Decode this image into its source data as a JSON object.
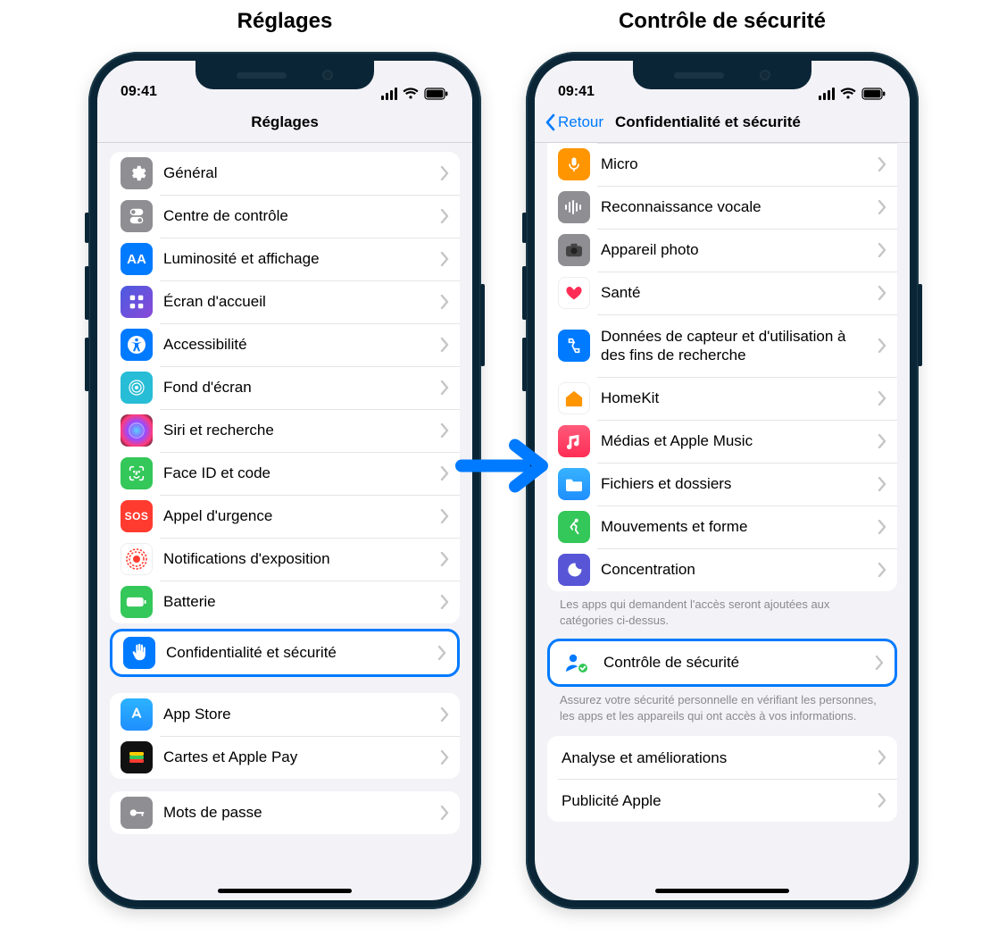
{
  "labels": {
    "left_title": "Réglages",
    "right_title": "Contrôle de sécurité"
  },
  "status": {
    "time": "09:41"
  },
  "phoneLeft": {
    "nav": {
      "title": "Réglages"
    },
    "group1": [
      {
        "label": "Général",
        "icon": "gear",
        "bg": "#8e8e93"
      },
      {
        "label": "Centre de contrôle",
        "icon": "control",
        "bg": "#8e8e93"
      },
      {
        "label": "Luminosité et affichage",
        "icon": "display",
        "bg": "#007aff"
      },
      {
        "label": "Écran d'accueil",
        "icon": "home-grid",
        "bg": "#3a3ad6"
      },
      {
        "label": "Accessibilité",
        "icon": "accessibility",
        "bg": "#007aff"
      },
      {
        "label": "Fond d'écran",
        "icon": "wallpaper",
        "bg": "#27bdd6"
      },
      {
        "label": "Siri et recherche",
        "icon": "siri",
        "bg": "#111"
      },
      {
        "label": "Face ID et code",
        "icon": "faceid",
        "bg": "#34c759"
      },
      {
        "label": "Appel d'urgence",
        "icon": "sos",
        "bg": "#ff3b30"
      },
      {
        "label": "Notifications d'exposition",
        "icon": "exposure",
        "bg": "#ffffff"
      },
      {
        "label": "Batterie",
        "icon": "battery",
        "bg": "#34c759"
      },
      {
        "label": "Confidentialité et sécurité",
        "icon": "hand",
        "bg": "#007aff",
        "highlight": true
      }
    ],
    "group2": [
      {
        "label": "App Store",
        "icon": "appstore",
        "bg": "#1f8fff"
      },
      {
        "label": "Cartes et Apple Pay",
        "icon": "wallet",
        "bg": "#111"
      }
    ],
    "group3": [
      {
        "label": "Mots de passe",
        "icon": "key",
        "bg": "#8e8e93"
      }
    ]
  },
  "phoneRight": {
    "nav": {
      "back": "Retour",
      "title": "Confidentialité et sécurité"
    },
    "group1": [
      {
        "label": "Micro",
        "icon": "mic",
        "bg": "#ff9500"
      },
      {
        "label": "Reconnaissance vocale",
        "icon": "speech",
        "bg": "#8e8e93"
      },
      {
        "label": "Appareil photo",
        "icon": "camera",
        "bg": "#8e8e93"
      },
      {
        "label": "Santé",
        "icon": "health",
        "bg": "#ffffff"
      },
      {
        "label": "Données de capteur et d'utilisation à des fins de recherche",
        "icon": "research",
        "bg": "#007aff"
      },
      {
        "label": "HomeKit",
        "icon": "home",
        "bg": "#ffffff"
      },
      {
        "label": "Médias et Apple Music",
        "icon": "music",
        "bg": "#ff2d55"
      },
      {
        "label": "Fichiers et dossiers",
        "icon": "folder",
        "bg": "#1f8fff"
      },
      {
        "label": "Mouvements et forme",
        "icon": "fitness",
        "bg": "#34c759"
      },
      {
        "label": "Concentration",
        "icon": "focus",
        "bg": "#5856d6"
      }
    ],
    "footnote1": "Les apps qui demandent l'accès seront ajoutées aux catégories ci-dessus.",
    "group2": [
      {
        "label": "Contrôle de sécurité",
        "icon": "safety",
        "bg": "#ffffff",
        "highlight": true
      }
    ],
    "footnote2": "Assurez votre sécurité personnelle en vérifiant les personnes, les apps et les appareils qui ont accès à vos informations.",
    "group3": [
      {
        "label": "Analyse et améliorations",
        "icon": "none"
      },
      {
        "label": "Publicité Apple",
        "icon": "none"
      }
    ]
  }
}
